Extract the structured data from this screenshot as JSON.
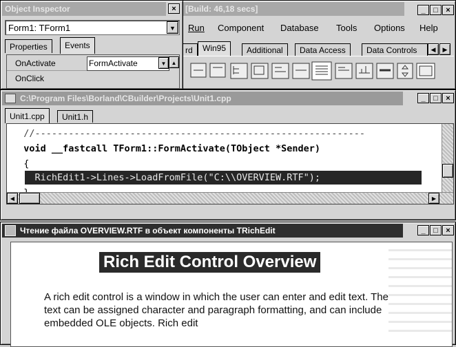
{
  "inspector": {
    "title": "Object Inspector",
    "object_value": "Form1: TForm1",
    "tabs": [
      "Properties",
      "Events"
    ],
    "rows": [
      {
        "name": "OnActivate",
        "value": "FormActivate"
      },
      {
        "name": "OnClick",
        "value": ""
      }
    ]
  },
  "main_window": {
    "title": "[Build: 46,18 secs]",
    "menu": [
      "Run",
      "Component",
      "Database",
      "Tools",
      "Options",
      "Help"
    ],
    "palette_tabs": [
      "rd",
      "Win95",
      "Additional",
      "Data Access",
      "Data Controls"
    ]
  },
  "editor": {
    "title": "C:\\Program Files\\Borland\\CBuilder\\Projects\\Unit1.cpp",
    "tabs": [
      "Unit1.cpp",
      "Unit1.h"
    ],
    "lines": [
      "  //-----------------------------------------------------------",
      "  void __fastcall TForm1::FormActivate(TObject *Sender)",
      "  {",
      "    RichEdit1->Lines->LoadFromFile(\"C:\\\\OVERVIEW.RTF\");",
      "  }"
    ]
  },
  "rich_window": {
    "title": "Чтение файла OVERVIEW.RTF в объект компоненты TRichEdit",
    "heading": "Rich Edit Control Overview",
    "body": "A rich edit control is a window in which the user can enter and edit text. The text can be assigned character and paragraph formatting, and can include embedded OLE objects. Rich edit"
  },
  "window_buttons": {
    "minimize": "_",
    "maximize": "□",
    "close": "×"
  }
}
